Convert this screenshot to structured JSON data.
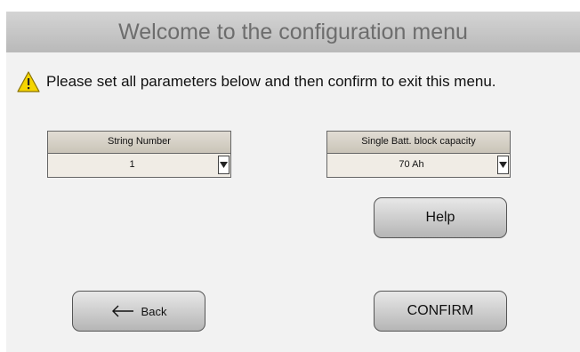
{
  "header": {
    "title": "Welcome to the configuration menu"
  },
  "notice": {
    "icon": "warning-icon",
    "text": "Please set all parameters below and then confirm to exit this menu."
  },
  "params": {
    "string_number": {
      "label": "String Number",
      "value": "1"
    },
    "block_capacity": {
      "label": "Single Batt. block capacity",
      "value": "70 Ah"
    }
  },
  "buttons": {
    "help": "Help",
    "back": "Back",
    "confirm": "CONFIRM"
  },
  "colors": {
    "warning": "#f5d500",
    "header_text": "#6d6d6d"
  }
}
